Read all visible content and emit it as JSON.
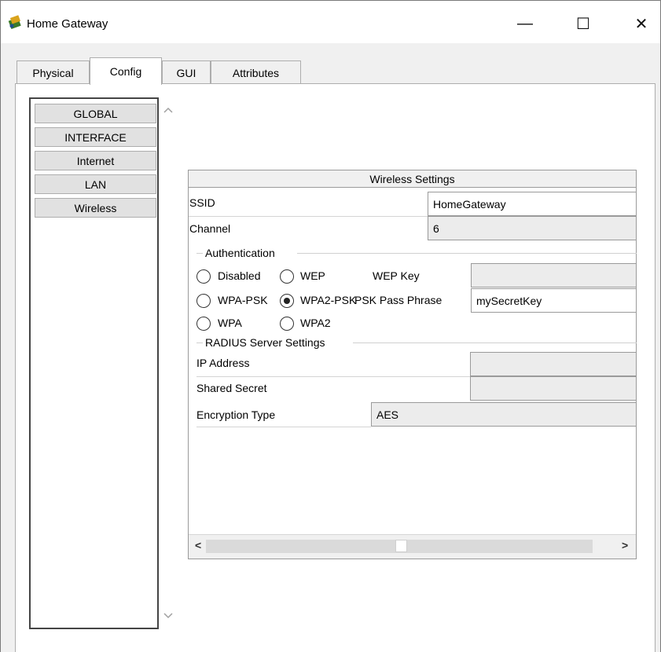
{
  "window": {
    "title": "Home Gateway",
    "minimize_glyph": "—",
    "maximize_glyph": "☐",
    "close_glyph": "✕"
  },
  "tabs": [
    {
      "label": "Physical",
      "active": false
    },
    {
      "label": "Config",
      "active": true
    },
    {
      "label": "GUI",
      "active": false
    },
    {
      "label": "Attributes",
      "active": false
    }
  ],
  "sidebar": {
    "items": [
      "GLOBAL",
      "INTERFACE",
      "Internet",
      "LAN",
      "Wireless"
    ],
    "selected": "Wireless"
  },
  "wireless": {
    "header": "Wireless Settings",
    "ssid_label": "SSID",
    "ssid_value": "HomeGateway",
    "channel_label": "Channel",
    "channel_value": "6",
    "auth_group_label": "Authentication",
    "auth_options": {
      "disabled": "Disabled",
      "wep": "WEP",
      "wpa_psk": "WPA-PSK",
      "wpa2_psk": "WPA2-PSK",
      "wpa": "WPA",
      "wpa2": "WPA2"
    },
    "auth_selected": "WPA2-PSK",
    "wep_key_label": "WEP Key",
    "wep_key_value": "",
    "psk_label": "PSK Pass Phrase",
    "psk_value": "mySecretKey",
    "radius_group_label": "RADIUS Server Settings",
    "ip_label": "IP Address",
    "ip_value": "",
    "secret_label": "Shared Secret",
    "secret_value": "",
    "encryption_label": "Encryption Type",
    "encryption_value": "AES"
  },
  "scroll": {
    "left_arrow": "<",
    "right_arrow": ">"
  },
  "colors": {
    "window_bg": "#f0f0f0",
    "panel_bg": "#ffffff",
    "field_border": "#9a9a9a"
  }
}
